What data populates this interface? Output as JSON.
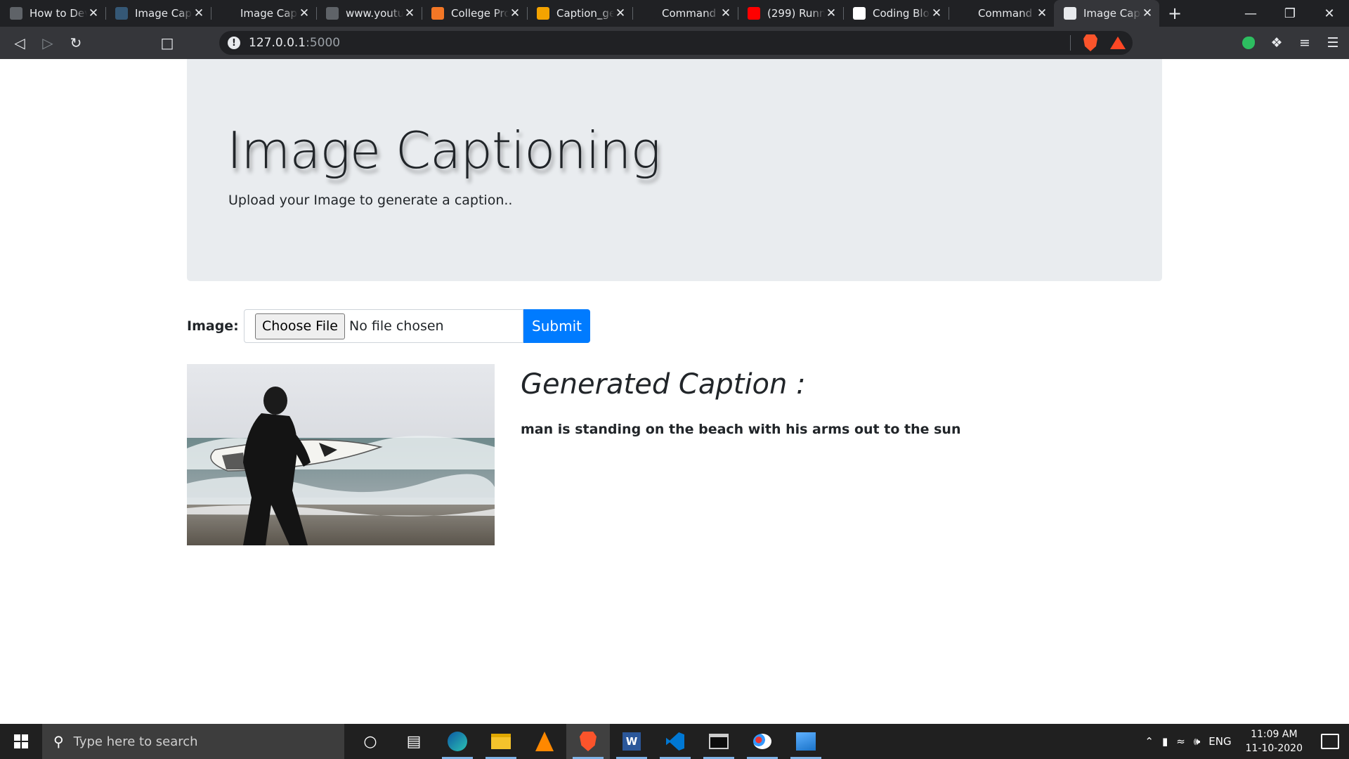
{
  "browser": {
    "tabs": [
      {
        "title": "How to Dev",
        "favicon": "page-icon",
        "color": "#5f6368",
        "active": false
      },
      {
        "title": "Image Capt",
        "favicon": "tds-icon",
        "color": "#355876",
        "active": false
      },
      {
        "title": "Image Capt",
        "favicon": "tds-circle-icon",
        "color": "#202124",
        "active": false
      },
      {
        "title": "www.youtut",
        "favicon": "globe-icon",
        "color": "#5f6368",
        "active": false
      },
      {
        "title": "College Pro",
        "favicon": "jupyter-icon",
        "color": "#f37726",
        "active": false
      },
      {
        "title": "Caption_ge",
        "favicon": "notebook-icon",
        "color": "#f4a300",
        "active": false
      },
      {
        "title": "Command L",
        "favicon": "phone-icon",
        "color": "#202124",
        "active": false
      },
      {
        "title": "(299) Runni",
        "favicon": "youtube-icon",
        "color": "#ff0000",
        "active": false
      },
      {
        "title": "Coding Blo",
        "favicon": "github-icon",
        "color": "#ffffff",
        "active": false
      },
      {
        "title": "Command L",
        "favicon": "phone-icon",
        "color": "#202124",
        "active": false
      },
      {
        "title": "Image Capt",
        "favicon": "globe-icon",
        "color": "#e8eaed",
        "active": true
      }
    ],
    "new_tab_label": "+",
    "url_host": "127.0.0.1",
    "url_port": ":5000"
  },
  "page": {
    "title": "Image Captioning",
    "subtitle": "Upload your Image to generate a caption..",
    "form": {
      "label": "Image:",
      "choose_file_label": "Choose File",
      "file_status": "No file chosen",
      "submit_label": "Submit"
    },
    "caption_heading": "Generated Caption :",
    "caption_text": "man is standing on the beach with his arms out to the sun",
    "accent_color": "#007bff"
  },
  "taskbar": {
    "search_placeholder": "Type here to search",
    "language": "ENG",
    "time": "11:09 AM",
    "date": "11-10-2020"
  }
}
